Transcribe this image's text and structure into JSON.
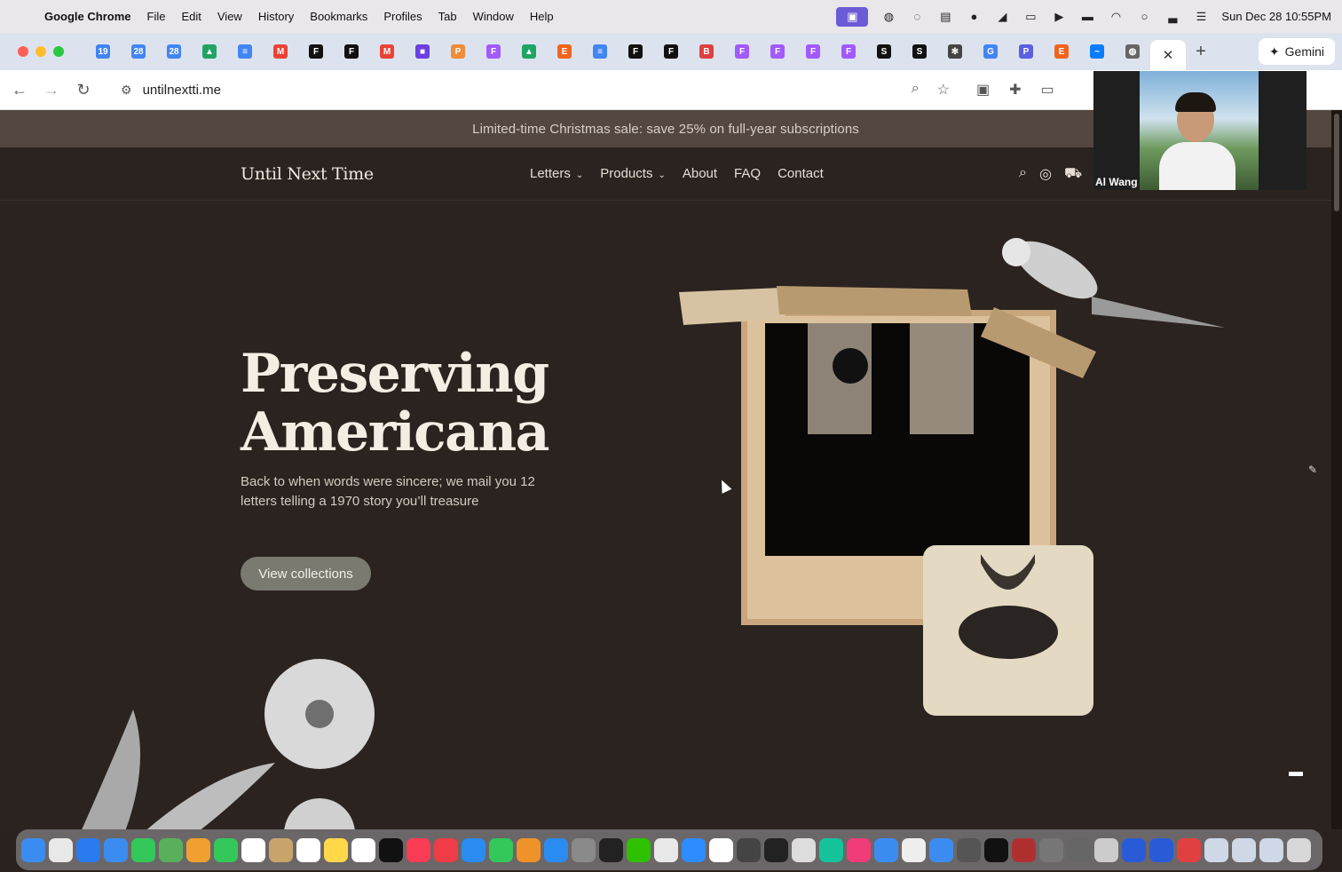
{
  "menubar": {
    "items": [
      "Google Chrome",
      "File",
      "Edit",
      "View",
      "History",
      "Bookmarks",
      "Profiles",
      "Tab",
      "Window",
      "Help"
    ],
    "clock": "Sun Dec 28  10:55PM"
  },
  "tabs": {
    "favicons": [
      {
        "icon": "calendar-icon",
        "color": "#4285f4",
        "text": "19"
      },
      {
        "icon": "calendar-icon",
        "color": "#4285f4",
        "text": "28"
      },
      {
        "icon": "calendar-icon",
        "color": "#4285f4",
        "text": "28"
      },
      {
        "icon": "drive-icon",
        "color": "#1fa463",
        "text": "▲"
      },
      {
        "icon": "docs-icon",
        "color": "#4285f4",
        "text": "≡"
      },
      {
        "icon": "gmail-icon",
        "color": "#ea4335",
        "text": "M"
      },
      {
        "icon": "framer-icon",
        "color": "#111111",
        "text": "F"
      },
      {
        "icon": "framer-icon",
        "color": "#111111",
        "text": "F"
      },
      {
        "icon": "gmail-icon",
        "color": "#ea4335",
        "text": "M"
      },
      {
        "icon": "app-icon",
        "color": "#6b3fe0",
        "text": "■"
      },
      {
        "icon": "app-icon",
        "color": "#f08c3a",
        "text": "P"
      },
      {
        "icon": "figma-icon",
        "color": "#a259ff",
        "text": "F"
      },
      {
        "icon": "drive-icon",
        "color": "#1fa463",
        "text": "▲"
      },
      {
        "icon": "etsy-icon",
        "color": "#f1641e",
        "text": "E"
      },
      {
        "icon": "docs-icon",
        "color": "#4285f4",
        "text": "≡"
      },
      {
        "icon": "framer-icon",
        "color": "#111111",
        "text": "F"
      },
      {
        "icon": "framer-icon",
        "color": "#111111",
        "text": "F"
      },
      {
        "icon": "app-icon",
        "color": "#e04040",
        "text": "B"
      },
      {
        "icon": "figma-icon",
        "color": "#a259ff",
        "text": "F"
      },
      {
        "icon": "figma-icon",
        "color": "#a259ff",
        "text": "F"
      },
      {
        "icon": "figma-icon",
        "color": "#a259ff",
        "text": "F"
      },
      {
        "icon": "figma-icon",
        "color": "#a259ff",
        "text": "F"
      },
      {
        "icon": "app-icon",
        "color": "#111111",
        "text": "S"
      },
      {
        "icon": "app-icon",
        "color": "#111111",
        "text": "S"
      },
      {
        "icon": "openai-icon",
        "color": "#444444",
        "text": "✻"
      },
      {
        "icon": "google-icon",
        "color": "#4285f4",
        "text": "G"
      },
      {
        "icon": "app-icon",
        "color": "#5b5fe0",
        "text": "P"
      },
      {
        "icon": "etsy-icon",
        "color": "#f1641e",
        "text": "E"
      },
      {
        "icon": "messenger-icon",
        "color": "#0a7cff",
        "text": "~"
      },
      {
        "icon": "globe-icon",
        "color": "#666666",
        "text": "◍"
      }
    ],
    "active_close": "✕",
    "new_tab": "+",
    "gemini_label": "Gemini"
  },
  "toolbar": {
    "url": "untilnextti.me"
  },
  "site": {
    "promo": "Limited-time Christmas sale: save 25% on full-year subscriptions",
    "logo": "Until Next Time",
    "nav": {
      "letters": "Letters",
      "products": "Products",
      "about": "About",
      "faq": "FAQ",
      "contact": "Contact"
    },
    "hero": {
      "title_line1": "Preserving",
      "title_line2": "Americana",
      "subtitle": "Back to when words were sincere; we mail you 12 letters telling a 1970 story you’ll treasure",
      "cta": "View collections"
    }
  },
  "video": {
    "name": "Al Wang"
  },
  "dock": {
    "apps": [
      {
        "icon": "finder-icon",
        "color": "#3b8cf0"
      },
      {
        "icon": "launchpad-icon",
        "color": "#e8e8e8"
      },
      {
        "icon": "safari-icon",
        "color": "#2a7bf0"
      },
      {
        "icon": "mail-icon",
        "color": "#3b8cf0"
      },
      {
        "icon": "messages-icon",
        "color": "#34c759"
      },
      {
        "icon": "maps-icon",
        "color": "#5ab05a"
      },
      {
        "icon": "photos-icon",
        "color": "#f0a030"
      },
      {
        "icon": "facetime-icon",
        "color": "#34c759"
      },
      {
        "icon": "calendar-icon",
        "color": "#ffffff"
      },
      {
        "icon": "notes-icon",
        "color": "#c9a46a"
      },
      {
        "icon": "reminders-icon",
        "color": "#ffffff"
      },
      {
        "icon": "notes-icon",
        "color": "#ffd84a"
      },
      {
        "icon": "freeform-icon",
        "color": "#ffffff"
      },
      {
        "icon": "tv-icon",
        "color": "#111111"
      },
      {
        "icon": "music-icon",
        "color": "#fa3c55"
      },
      {
        "icon": "news-icon",
        "color": "#f03c46"
      },
      {
        "icon": "keynote-icon",
        "color": "#2a8bf0"
      },
      {
        "icon": "numbers-icon",
        "color": "#34c759"
      },
      {
        "icon": "pages-icon",
        "color": "#f0922a"
      },
      {
        "icon": "appstore-icon",
        "color": "#2a8bf0"
      },
      {
        "icon": "settings-icon",
        "color": "#8a8a8a"
      },
      {
        "icon": "activity-icon",
        "color": "#222222"
      },
      {
        "icon": "wechat-icon",
        "color": "#2dc100"
      },
      {
        "icon": "chrome-icon",
        "color": "#e8e8e8"
      },
      {
        "icon": "zoom-icon",
        "color": "#2d8cff"
      },
      {
        "icon": "slack-icon",
        "color": "#ffffff"
      },
      {
        "icon": "calculator-icon",
        "color": "#444444"
      },
      {
        "icon": "terminal-icon",
        "color": "#222222"
      },
      {
        "icon": "preview-icon",
        "color": "#dddddd"
      },
      {
        "icon": "grammarly-icon",
        "color": "#15c39a"
      },
      {
        "icon": "app-icon",
        "color": "#f03c78"
      },
      {
        "icon": "app-icon",
        "color": "#3b8cf0"
      },
      {
        "icon": "app-icon",
        "color": "#eeeeee"
      },
      {
        "icon": "quicktime-icon",
        "color": "#3b8cf0"
      },
      {
        "icon": "app-icon",
        "color": "#555555"
      },
      {
        "icon": "framer-icon",
        "color": "#111111"
      },
      {
        "icon": "dictionary-icon",
        "color": "#b03030"
      },
      {
        "icon": "printer-icon",
        "color": "#777777"
      },
      {
        "icon": "app-icon",
        "color": "#666666"
      },
      {
        "icon": "fonts-icon",
        "color": "#cccccc"
      },
      {
        "icon": "app-icon",
        "color": "#2a5bd7"
      },
      {
        "icon": "app-icon",
        "color": "#2a5bd7"
      },
      {
        "icon": "app-icon",
        "color": "#e04040"
      },
      {
        "icon": "folder-icon",
        "color": "#cfd8e6"
      },
      {
        "icon": "folder-icon",
        "color": "#cfd8e6"
      },
      {
        "icon": "folder-icon",
        "color": "#cfd8e6"
      },
      {
        "icon": "trash-icon",
        "color": "#d8d8d8"
      }
    ]
  }
}
